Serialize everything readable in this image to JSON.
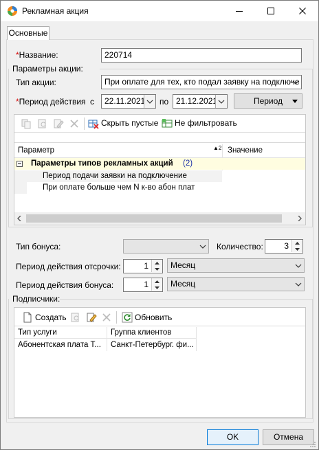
{
  "window": {
    "title": "Рекламная акция"
  },
  "tabs": [
    {
      "label": "Основные"
    }
  ],
  "form": {
    "name_label": "Название:",
    "name_value": "220714",
    "params_group_label": "Параметры акции:",
    "action_type_label": "Тип акции:",
    "action_type_value": "При оплате для тех, кто подал заявку на подключе",
    "period_label": "Период действия",
    "period_from_label": "с",
    "period_from_value": "22.11.2021",
    "period_to_label": "по",
    "period_to_value": "21.12.2021",
    "period_button": "Период"
  },
  "params_toolbar": {
    "hide_empty_label": "Скрыть пустые",
    "no_filter_label": "Не фильтровать"
  },
  "params_grid": {
    "col_param": "Параметр",
    "col_value": "Значение",
    "sort_indicator": "▲2",
    "group_label": "Параметры типов рекламных акций",
    "group_count": "(2)",
    "rows": [
      {
        "param": "Период подачи заявки на подключение",
        "value": ""
      },
      {
        "param": "При оплате больше чем N к-во абон плат",
        "value": ""
      }
    ]
  },
  "bonus": {
    "bonus_type_label": "Тип бонуса:",
    "bonus_type_value": "",
    "quantity_label": "Количество:",
    "quantity_value": "3",
    "deferral_period_label": "Период действия отсрочки:",
    "deferral_period_value": "1",
    "deferral_unit": "Месяц",
    "bonus_period_label": "Период действия бонуса:",
    "bonus_period_value": "1",
    "bonus_unit": "Месяц"
  },
  "subscribers": {
    "group_label": "Подписчики:",
    "create_label": "Создать",
    "refresh_label": "Обновить",
    "col_service_type": "Тип услуги",
    "col_client_group": "Группа клиентов",
    "rows": [
      {
        "service_type": "Абонентская плата Т...",
        "client_group": "Санкт-Петербург. фи..."
      }
    ]
  },
  "footer": {
    "ok_label": "OK",
    "cancel_label": "Отмена"
  },
  "colors": {
    "required": "#d40000",
    "group_row_bg": "#fffde0",
    "sub_row_bg": "#f2f2f2",
    "accent_border": "#0078d7"
  }
}
